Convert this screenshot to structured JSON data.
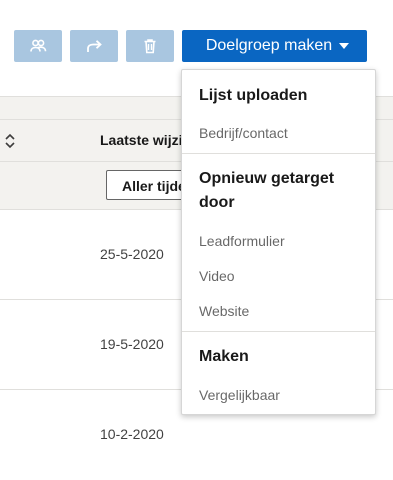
{
  "toolbar": {
    "icons": [
      "users-icon",
      "share-icon",
      "trash-icon"
    ],
    "primary_button_label": "Doelgroep maken"
  },
  "table": {
    "column_header": "Laatste wijzi",
    "filter_button_label": "Aller tijde",
    "rows": [
      {
        "date": "25-5-2020"
      },
      {
        "date": "19-5-2020"
      },
      {
        "date": "10-2-2020"
      }
    ]
  },
  "dropdown": {
    "sections": [
      {
        "title": "Lijst uploaden",
        "items": [
          "Bedrijf/contact"
        ]
      },
      {
        "title": "Opnieuw getarget door",
        "items": [
          "Leadformulier",
          "Video",
          "Website"
        ]
      },
      {
        "title": "Maken",
        "items": [
          "Vergelijkbaar"
        ]
      }
    ]
  },
  "colors": {
    "primary": "#0a66c2",
    "disabled_button": "#a9c6e0",
    "header_background": "#f3f2ef",
    "border": "#e0dfdc"
  }
}
